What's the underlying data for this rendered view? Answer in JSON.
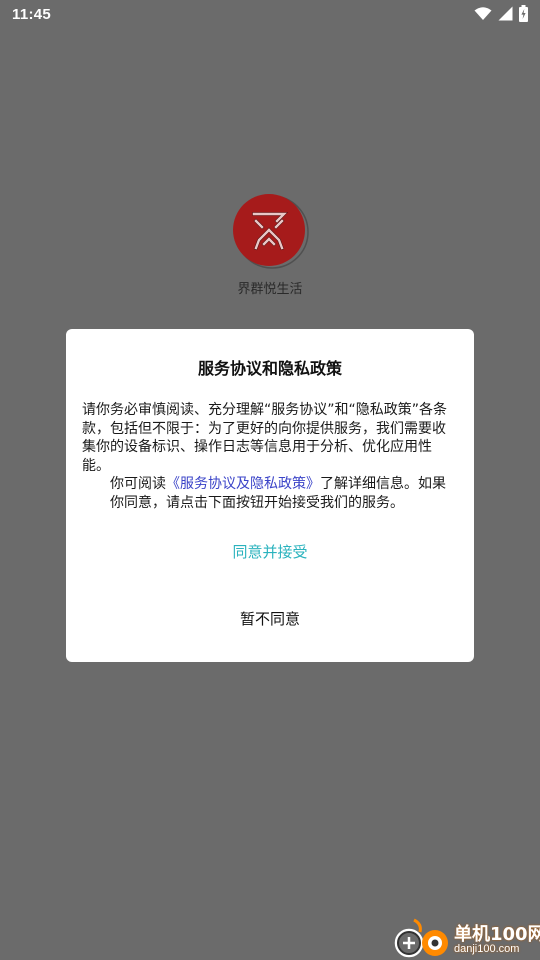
{
  "status_bar": {
    "time": "11:45",
    "icons": [
      "wifi-icon",
      "signal-icon",
      "battery-charging-icon"
    ]
  },
  "splash": {
    "app_name": "界群悦生活",
    "logo_color": "#a61b1b"
  },
  "dialog": {
    "title": "服务协议和隐私政策",
    "paragraph1": "请你务必审慎阅读、充分理解“服务协议”和“隐私政策”各条款，包括但不限于：为了更好的向你提供服务，我们需要收集你的设备标识、操作日志等信息用于分析、优化应用性能。",
    "paragraph2_before": "你可阅读",
    "paragraph2_link": "《服务协议及隐私政策》",
    "paragraph2_after": "了解详细信息。如果你同意，请点击下面按钮开始接受我们的服务。",
    "agree_label": "同意并接受",
    "disagree_label": "暂不同意",
    "agree_color": "#2bb3be",
    "link_color": "#3b44c8"
  },
  "watermark": {
    "text_cn": "单机100网",
    "text_en": "danji100.com"
  }
}
